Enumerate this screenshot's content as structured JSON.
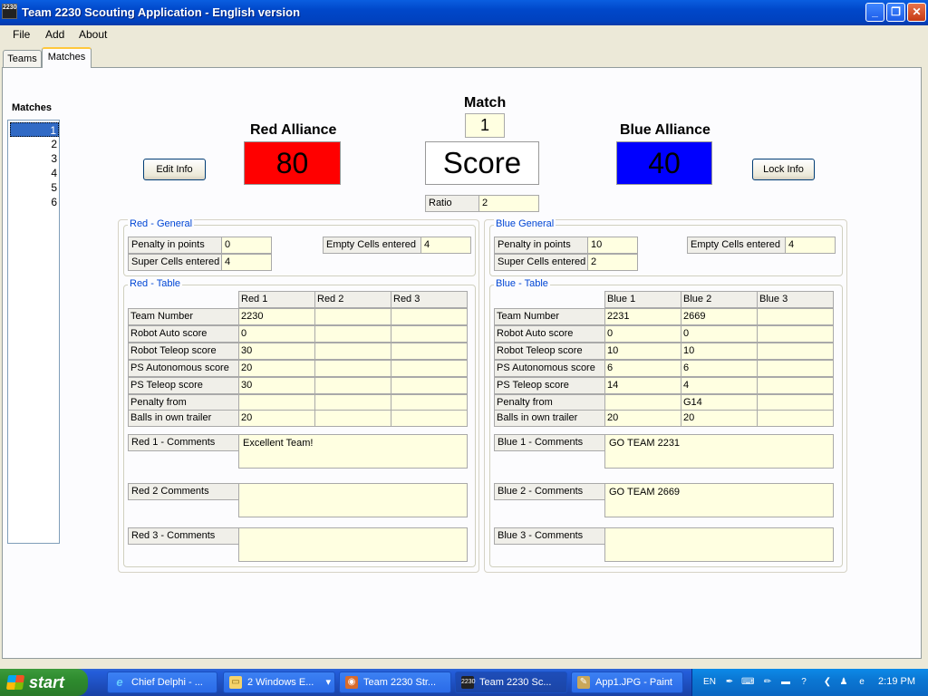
{
  "window": {
    "title": "Team 2230 Scouting Application - English version",
    "app_icon_text": "2230"
  },
  "menu": {
    "file": "File",
    "add": "Add",
    "about": "About"
  },
  "tabs": {
    "teams": "Teams",
    "matches": "Matches"
  },
  "matches": {
    "label": "Matches",
    "items": [
      "1",
      "2",
      "3",
      "4",
      "5",
      "6"
    ],
    "selected": "1"
  },
  "header": {
    "match_label": "Match",
    "match_number": "1",
    "red_alliance": "Red Alliance",
    "red_score": "80",
    "blue_alliance": "Blue Alliance",
    "blue_score": "40",
    "score_label": "Score",
    "ratio_label": "Ratio",
    "ratio_value": "2",
    "edit_info": "Edit Info",
    "lock_info": "Lock Info"
  },
  "colors": {
    "red": "#ff0000",
    "blue": "#0000ff",
    "field_bg": "#ffffe1",
    "group_title": "#0046d5"
  },
  "red_general": {
    "title": "Red - General",
    "penalty_label": "Penalty in points",
    "penalty_value": "0",
    "empty_label": "Empty Cells entered",
    "empty_value": "4",
    "super_label": "Super Cells entered",
    "super_value": "4"
  },
  "blue_general": {
    "title": "Blue General",
    "penalty_label": "Penalty in points",
    "penalty_value": "10",
    "empty_label": "Empty Cells entered",
    "empty_value": "4",
    "super_label": "Super Cells entered",
    "super_value": "2"
  },
  "red_table": {
    "title": "Red - Table",
    "columns": [
      "Red 1",
      "Red 2",
      "Red 3"
    ],
    "rows": [
      {
        "label": "Team Number",
        "values": [
          "2230",
          "",
          ""
        ]
      },
      {
        "label": "Robot Auto score",
        "values": [
          "0",
          "",
          ""
        ]
      },
      {
        "label": "Robot Teleop score",
        "values": [
          "30",
          "",
          ""
        ]
      },
      {
        "label": "PS Autonomous score",
        "values": [
          "20",
          "",
          ""
        ]
      },
      {
        "label": "PS Teleop score",
        "values": [
          "30",
          "",
          ""
        ]
      },
      {
        "label": "Penalty from",
        "values": [
          "",
          "",
          ""
        ]
      },
      {
        "label": "Balls in own trailer",
        "values": [
          "20",
          "",
          ""
        ]
      }
    ],
    "comments": [
      {
        "label": "Red 1 - Comments",
        "text": "Excellent Team!"
      },
      {
        "label": "Red 2  Comments",
        "text": ""
      },
      {
        "label": "Red 3 - Comments",
        "text": ""
      }
    ]
  },
  "blue_table": {
    "title": "Blue - Table",
    "columns": [
      "Blue 1",
      "Blue 2",
      "Blue 3"
    ],
    "rows": [
      {
        "label": "Team Number",
        "values": [
          "2231",
          "2669",
          ""
        ]
      },
      {
        "label": "Robot Auto score",
        "values": [
          "0",
          "0",
          ""
        ]
      },
      {
        "label": "Robot Teleop score",
        "values": [
          "10",
          "10",
          ""
        ]
      },
      {
        "label": "PS Autonomous score",
        "values": [
          "6",
          "6",
          ""
        ]
      },
      {
        "label": "PS Teleop score",
        "values": [
          "14",
          "4",
          ""
        ]
      },
      {
        "label": "Penalty from",
        "values": [
          "",
          "G14",
          ""
        ]
      },
      {
        "label": "Balls in own trailer",
        "values": [
          "20",
          "20",
          ""
        ]
      }
    ],
    "comments": [
      {
        "label": "Blue 1 - Comments",
        "text": "GO TEAM 2231"
      },
      {
        "label": "Blue 2 - Comments",
        "text": "GO TEAM 2669"
      },
      {
        "label": "Blue 3 - Comments",
        "text": ""
      }
    ]
  },
  "taskbar": {
    "start": "start",
    "buttons": [
      "Chief Delphi - ...",
      "2 Windows E...",
      "Team 2230 Str...",
      "Team 2230 Sc...",
      "App1.JPG - Paint"
    ],
    "language": "EN",
    "clock": "2:19 PM"
  }
}
